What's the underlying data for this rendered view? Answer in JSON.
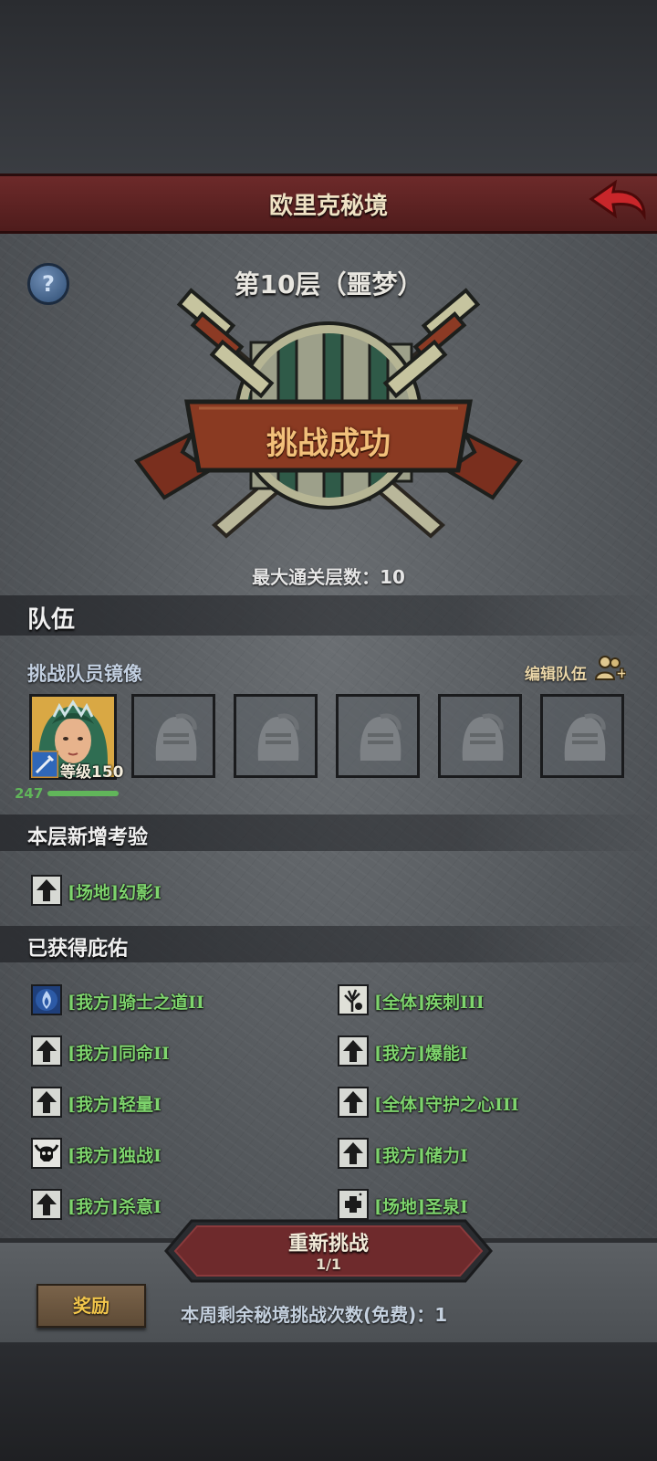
{
  "header": {
    "title": "欧里克秘境"
  },
  "floor": {
    "title": "第10层（噩梦）",
    "result": "挑战成功",
    "max_cleared": "最大通关层数：10"
  },
  "team": {
    "section_title": "队伍",
    "subtitle": "挑战队员镜像",
    "edit_label": "编辑队伍",
    "hero": {
      "level": "等级150",
      "power": "247"
    },
    "empty_slots": 5
  },
  "new_trials": {
    "section_title": "本层新增考验",
    "items": [
      {
        "label": "[场地]幻影I",
        "icon": "up-arrow-icon"
      }
    ]
  },
  "blessings": {
    "section_title": "已获得庇佑",
    "items": [
      {
        "label": "[我方]骑士之道II",
        "icon": "knight-flame-icon"
      },
      {
        "label": "[全体]疾刺III",
        "icon": "tree-icon"
      },
      {
        "label": "[我方]同命II",
        "icon": "up-arrow-icon"
      },
      {
        "label": "[我方]爆能I",
        "icon": "up-arrow-icon"
      },
      {
        "label": "[我方]轻量I",
        "icon": "up-arrow-icon"
      },
      {
        "label": "[全体]守护之心III",
        "icon": "up-arrow-icon"
      },
      {
        "label": "[我方]独战I",
        "icon": "horned-skull-icon"
      },
      {
        "label": "[我方]储力I",
        "icon": "up-arrow-icon"
      },
      {
        "label": "[我方]杀意I",
        "icon": "up-arrow-icon"
      },
      {
        "label": "[场地]圣泉I",
        "icon": "plus-icon"
      }
    ]
  },
  "footer": {
    "retry_label": "重新挑战",
    "retry_count": "1/1",
    "reward_label": "奖励",
    "remaining": "本周剩余秘境挑战次数(免费)：1"
  },
  "colors": {
    "blessing_text": "#7ed46d",
    "title_bar": "#6d2a2a",
    "reward_text": "#f3c64b"
  }
}
